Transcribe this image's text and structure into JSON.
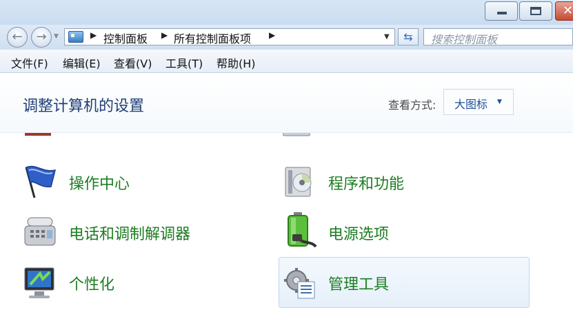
{
  "window": {
    "buttons": {
      "minimize": "minimize-icon",
      "maximize": "maximize-icon",
      "close": "close-icon"
    }
  },
  "address": {
    "crumbs": [
      "控制面板",
      "所有控制面板项"
    ],
    "search_placeholder": "搜索控制面板"
  },
  "menu": [
    "文件(F)",
    "编辑(E)",
    "查看(V)",
    "工具(T)",
    "帮助(H)"
  ],
  "header": {
    "title": "调整计算机的设置",
    "view_label": "查看方式:",
    "view_value": "大图标"
  },
  "items": [
    {
      "label": "操作中心",
      "icon": "action-center-flag-icon"
    },
    {
      "label": "程序和功能",
      "icon": "programs-features-icon"
    },
    {
      "label": "电话和调制解调器",
      "icon": "phone-modem-icon"
    },
    {
      "label": "电源选项",
      "icon": "power-options-battery-icon"
    },
    {
      "label": "个性化",
      "icon": "personalization-monitor-icon"
    },
    {
      "label": "管理工具",
      "icon": "administrative-tools-gear-icon"
    }
  ],
  "colors": {
    "item_text": "#1b7d21",
    "title_text": "#1e3f75",
    "link_blue": "#1f4f9a"
  }
}
